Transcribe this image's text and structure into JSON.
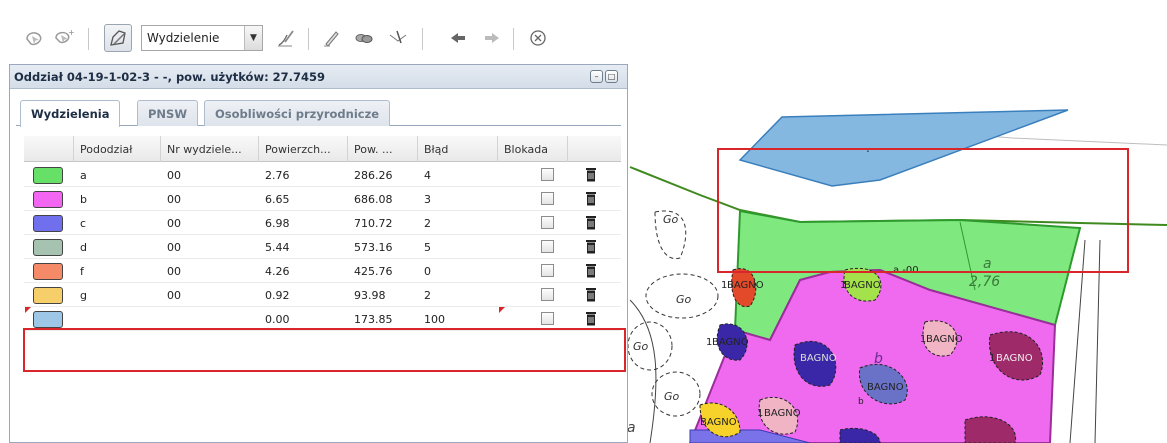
{
  "toolbar": {
    "layer_select": {
      "value": "Wydzielenie"
    },
    "icons": [
      "select-shape-icon",
      "select-multi-icon",
      "draw-polygon-icon",
      "split-line-icon",
      "edit-pencil-icon",
      "merge-icon",
      "cut-icon",
      "arrow-left-icon",
      "arrow-right-icon",
      "close-circle-icon"
    ]
  },
  "panel": {
    "title": "Oddział 04-19-1-02-3 - -, pow. użytków: 27.7459",
    "tabs": [
      {
        "label": "Wydzielenia",
        "active": true
      },
      {
        "label": "PNSW",
        "active": false
      },
      {
        "label": "Osobliwości przyrodnicze",
        "active": false
      }
    ],
    "columns": [
      "Pododział",
      "Nr wydziele...",
      "Powierzch...",
      "Pow. ...",
      "Błąd",
      "Blokada"
    ],
    "rows": [
      {
        "color": "#66e066",
        "pododzial": "a",
        "nr": "00",
        "powierzchnia": "2.76",
        "pow": "286.26",
        "blad": "4"
      },
      {
        "color": "#f266f2",
        "pododzial": "b",
        "nr": "00",
        "powierzchnia": "6.65",
        "pow": "686.08",
        "blad": "3"
      },
      {
        "color": "#7070ee",
        "pododzial": "c",
        "nr": "00",
        "powierzchnia": "6.98",
        "pow": "710.72",
        "blad": "2"
      },
      {
        "color": "#a6c2b0",
        "pododzial": "d",
        "nr": "00",
        "powierzchnia": "5.44",
        "pow": "573.16",
        "blad": "5"
      },
      {
        "color": "#f58a68",
        "pododzial": "f",
        "nr": "00",
        "powierzchnia": "4.26",
        "pow": "425.76",
        "blad": "0"
      },
      {
        "color": "#f6cf6a",
        "pododzial": "g",
        "nr": "00",
        "powierzchnia": "0.92",
        "pow": "93.98",
        "blad": "2"
      },
      {
        "color": "#9ec6e6",
        "pododzial": "",
        "nr": "",
        "powierzchnia": "0.00",
        "pow": "173.85",
        "blad": "100"
      }
    ]
  },
  "map": {
    "labels": {
      "go1": "Go",
      "go2": "Go",
      "go3": "Go",
      "go4": "Go",
      "a_label": "a",
      "a_area": "2,76",
      "a_code": "a  -00",
      "bagno": "BAGNO",
      "b_label": "b",
      "b_small": "b",
      "one": "1",
      "a_bottom": "a",
      "dot": "."
    }
  }
}
